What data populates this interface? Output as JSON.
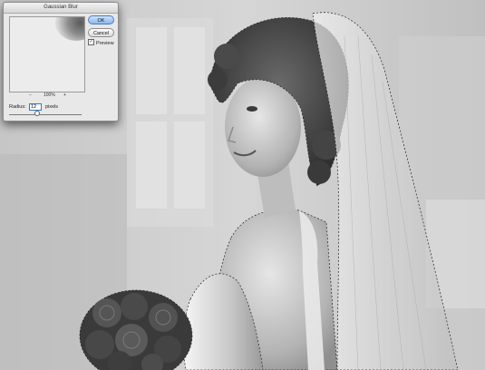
{
  "dialog": {
    "title": "Gaussian Blur",
    "ok_label": "OK",
    "cancel_label": "Cancel",
    "preview_label": "Preview",
    "preview_checked": true,
    "zoom_out_glyph": "−",
    "zoom_in_glyph": "+",
    "zoom_level": "100%",
    "radius_label": "Radius:",
    "radius_value": "12",
    "radius_unit": "pixels"
  },
  "canvas": {
    "content": "bride-portrait-photo",
    "selection": "marching-ants"
  }
}
